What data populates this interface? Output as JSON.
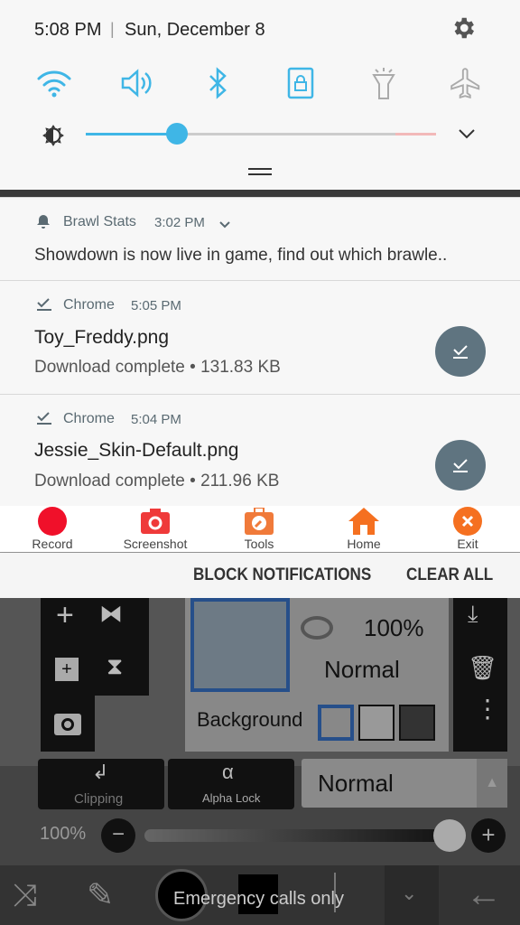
{
  "status": {
    "time": "5:08 PM",
    "separator": "|",
    "date": "Sun, December 8",
    "settings_icon": "gear-icon"
  },
  "quick_settings": [
    {
      "name": "wifi-icon",
      "active": true
    },
    {
      "name": "sound-icon",
      "active": true
    },
    {
      "name": "bluetooth-icon",
      "active": true
    },
    {
      "name": "screen-rotation-lock-icon",
      "active": true
    },
    {
      "name": "flashlight-icon",
      "active": false
    },
    {
      "name": "airplane-mode-icon",
      "active": false
    }
  ],
  "brightness": {
    "level": 0.25,
    "icon": "brightness-icon"
  },
  "accent": "#3fb6e6",
  "notifications": [
    {
      "app": "Brawl Stats",
      "time": "3:02 PM",
      "text": "Showdown is now live in game, find out which brawle.."
    },
    {
      "app": "Chrome",
      "time": "5:05 PM",
      "title": "Toy_Freddy.png",
      "text": "Download complete • 131.83 KB"
    },
    {
      "app": "Chrome",
      "time": "5:04 PM",
      "title": "Jessie_Skin-Default.png",
      "text": "Download complete • 211.96 KB"
    }
  ],
  "recorder": [
    {
      "label": "Record",
      "color": "#f0102a"
    },
    {
      "label": "Screenshot",
      "color": "#ef3a3a"
    },
    {
      "label": "Tools",
      "color": "#f07a3a"
    },
    {
      "label": "Home",
      "color": "#f57020"
    },
    {
      "label": "Exit",
      "color": "#f57020"
    }
  ],
  "actions": {
    "block": "BLOCK NOTIFICATIONS",
    "clear": "CLEAR ALL"
  },
  "app": {
    "layer_opacity": "100%",
    "layer_blend": "Normal",
    "background_label": "Background",
    "clipping": "Clipping",
    "alpha_lock": "Alpha Lock",
    "blend_mode": "Normal",
    "opacity": "100%",
    "opacity_level": 1.0,
    "emergency": "Emergency calls only"
  }
}
